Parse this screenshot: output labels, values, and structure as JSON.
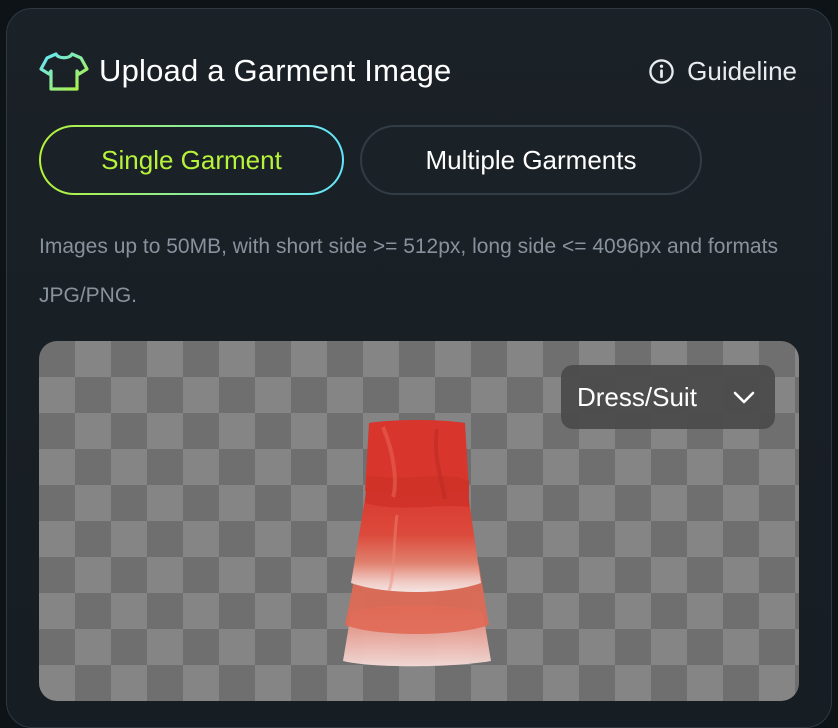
{
  "header": {
    "title": "Upload a Garment Image",
    "title_icon": "tshirt-icon",
    "guideline_label": "Guideline",
    "guideline_icon": "info-circle-icon"
  },
  "tabs": [
    {
      "label": "Single Garment",
      "selected": true
    },
    {
      "label": "Multiple Garments",
      "selected": false
    }
  ],
  "help_text": "Images up to 50MB, with short side >= 512px, long side <= 4096px and formats JPG/PNG.",
  "preview": {
    "garment_image": "red-strapless-tiered-dress",
    "category_selected": "Dress/Suit",
    "category_icon": "chevron-down-icon"
  },
  "colors": {
    "accent_green": "#b7f33a",
    "accent_cyan": "#62e6ff",
    "panel_bg": "#1a2127",
    "muted_text": "#88929c"
  }
}
